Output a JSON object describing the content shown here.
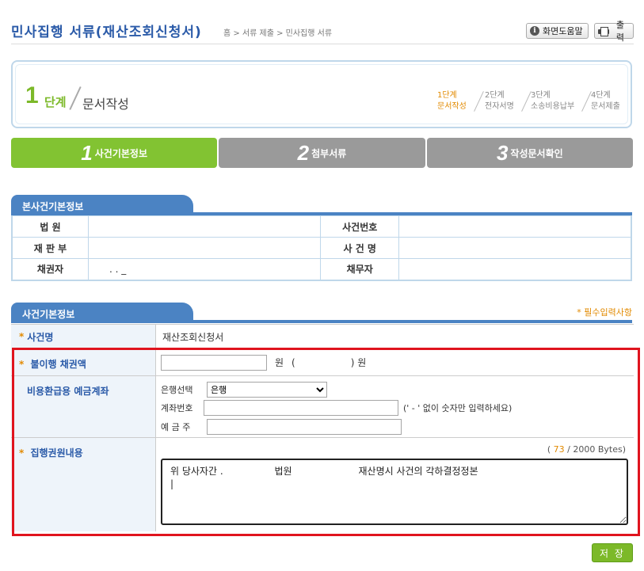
{
  "header": {
    "title": "민사집행 서류(재산조회신청서)",
    "breadcrumb": "홈 > 서류 제출 > 민사집행 서류",
    "help_label": "화면도움말",
    "print_label": "출력"
  },
  "step": {
    "number": "1",
    "word": "단계",
    "title": "문서작성",
    "progress": [
      {
        "step": "1단계",
        "name": "문서작성"
      },
      {
        "step": "2단계",
        "name": "전자서명"
      },
      {
        "step": "3단계",
        "name": "소송비용납부"
      },
      {
        "step": "4단계",
        "name": "문서제출"
      }
    ]
  },
  "tabs": [
    {
      "num": "1",
      "label": "사건기본정보"
    },
    {
      "num": "2",
      "label": "첨부서류"
    },
    {
      "num": "3",
      "label": "작성문서확인"
    }
  ],
  "info": {
    "heading": "본사건기본정보",
    "court_label": "법 원",
    "case_no_label": "사건번호",
    "division_label": "재 판 부",
    "case_name_label": "사 건 명",
    "creditor_label": "채권자",
    "creditor_value": ". . _",
    "debtor_label": "채무자"
  },
  "form": {
    "heading": "사건기본정보",
    "required_note": "* 필수입력사항",
    "case_name_label": "사건명",
    "case_name_value": "재산조회신청서",
    "amount_label": "불이행 채권액",
    "amount_unit": "원",
    "amount_paren_open": "(",
    "amount_paren_close": ") 원",
    "account_label": "비용환급용 예금계좌",
    "bank_label": "은행선택",
    "bank_option": "은행",
    "account_no_label": "계좌번호",
    "account_hint": "(' - ' 없이 숫자만 입력하세요)",
    "depositor_label": "예 금 주",
    "content_label": "집행권원내용",
    "byte_open": "(",
    "byte_count": "73",
    "byte_rest": "/ 2000 Bytes)",
    "content_value": "위 당사자간 .                 법원                      재산명시 사건의 각하결정정본\n|"
  },
  "save_label": "저 장",
  "colors": {
    "accent_green": "#82c332",
    "section_blue": "#4b83c3",
    "required_orange": "#e28a00",
    "highlight_red": "#e0141e"
  }
}
